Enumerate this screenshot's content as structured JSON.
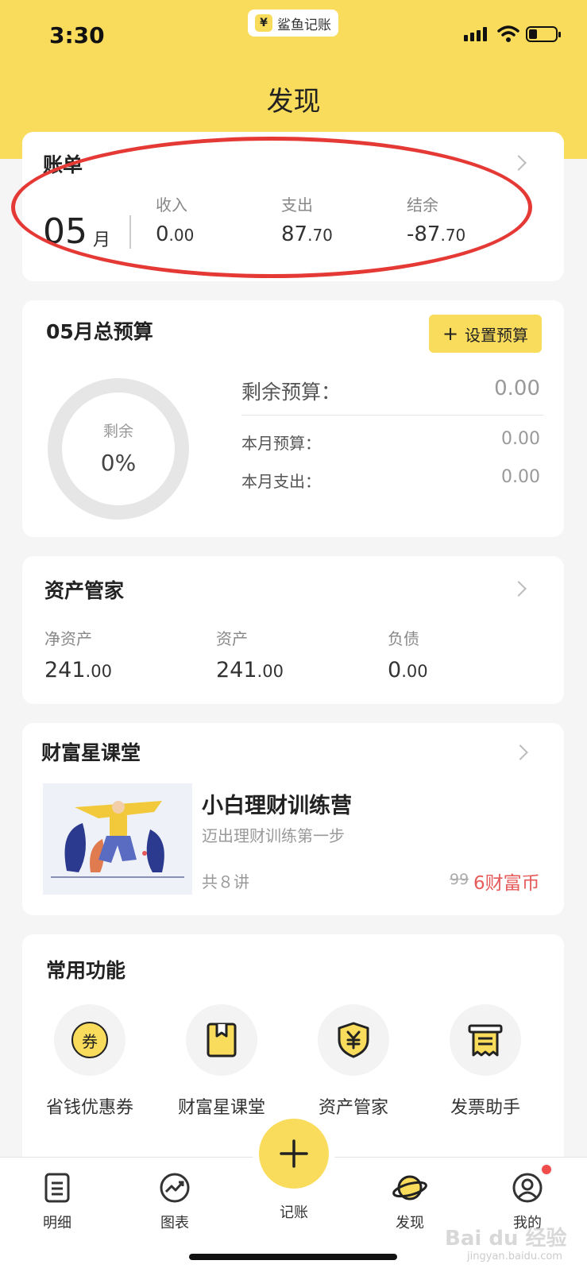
{
  "status": {
    "time": "3:30",
    "app_pill": "鲨鱼记账",
    "yen": "¥"
  },
  "page": {
    "title": "发现"
  },
  "bill": {
    "title": "账单",
    "month": "05",
    "month_unit": "月",
    "income_label": "收入",
    "income_int": "0",
    "income_dec": ".00",
    "expense_label": "支出",
    "expense_int": "87",
    "expense_dec": ".70",
    "balance_label": "结余",
    "balance_int": "-87",
    "balance_dec": ".70"
  },
  "budget": {
    "title": "05月总预算",
    "button_label": "设置预算",
    "ring_label": "剩余",
    "ring_value": "0%",
    "remaining_label": "剩余预算：",
    "remaining_value": "0.00",
    "month_budget_label": "本月预算：",
    "month_budget_value": "0.00",
    "month_expense_label": "本月支出：",
    "month_expense_value": "0.00"
  },
  "assets": {
    "title": "资产管家",
    "net_label": "净资产",
    "net_int": "241",
    "net_dec": ".00",
    "asset_label": "资产",
    "asset_int": "241",
    "asset_dec": ".00",
    "debt_label": "负债",
    "debt_int": "0",
    "debt_dec": ".00"
  },
  "course": {
    "title": "财富星课堂",
    "name": "小白理财训练营",
    "subtitle": "迈出理财训练第一步",
    "count": "共８讲",
    "old_price": "99",
    "price": "6财富币"
  },
  "features": {
    "title": "常用功能",
    "coupon_icon_text": "券",
    "items": [
      {
        "label": "省钱优惠券",
        "icon": "coupon-icon"
      },
      {
        "label": "财富星课堂",
        "icon": "book-icon"
      },
      {
        "label": "资产管家",
        "icon": "shield-yen-icon"
      },
      {
        "label": "发票助手",
        "icon": "receipt-icon"
      }
    ]
  },
  "tabbar": {
    "items": [
      {
        "label": "明细",
        "icon": "list-icon"
      },
      {
        "label": "图表",
        "icon": "chart-icon"
      },
      {
        "label": "记账",
        "icon": "plus-icon"
      },
      {
        "label": "发现",
        "icon": "planet-icon"
      },
      {
        "label": "我的",
        "icon": "user-icon"
      }
    ]
  },
  "watermark": {
    "text": "Bai du 经验",
    "sub": "jingyan.baidu.com"
  },
  "colors": {
    "accent": "#f9dc5c",
    "annotation": "#e53935",
    "price": "#e65a5a"
  },
  "battery_level": 0.3
}
